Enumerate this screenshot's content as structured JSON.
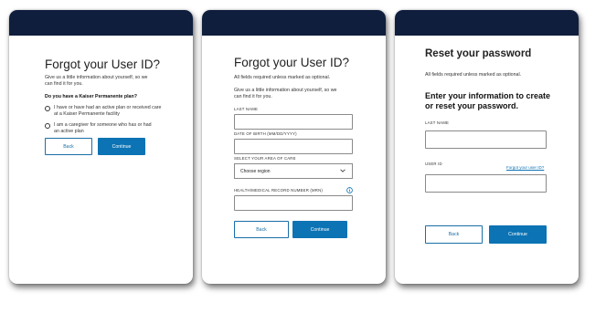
{
  "card1": {
    "title": "Forgot your User ID?",
    "intro_line1": "Give us a little information about yourself, so we",
    "intro_line2": "can find it for you.",
    "question": "Do you have a Kaiser Permanente plan?",
    "option1_line1": "I have or have had an active plan or received care",
    "option1_line2": "at a Kaiser Permanente facility",
    "option2_line1": "I am a caregiver for someone who has or had",
    "option2_line2": "an active plan",
    "back_label": "Back",
    "continue_label": "Continue"
  },
  "card2": {
    "title": "Forgot your User ID?",
    "required_note": "All fields required unless marked as optional.",
    "intro_line1": "Give us a little information about yourself, so we",
    "intro_line2": "can find it for you.",
    "last_name_label": "LAST NAME",
    "dob_label": "DATE OF BIRTH (MM/DD/YYYY)",
    "area_label": "SELECT YOUR AREA OF CARE",
    "region_value": "Choose region",
    "mrn_label": "HEALTH/MEDICAL RECORD NUMBER (MRN)",
    "back_label": "Back",
    "continue_label": "Continue"
  },
  "card3": {
    "title": "Reset your password",
    "required_note": "All fields required unless marked as optional.",
    "subtitle_line1": "Enter your information to create",
    "subtitle_line2": "or reset your password.",
    "last_name_label": "LAST NAME",
    "user_id_label": "USER ID",
    "forgot_link": "Forgot your user ID?",
    "back_label": "Back",
    "continue_label": "Continue"
  },
  "colors": {
    "header_bar": "#0f1e3d",
    "primary": "#0c73b4",
    "link": "#0c73b4"
  },
  "icons": {
    "select_chevron": "chevron-down-icon",
    "mrn_help": "info-icon"
  }
}
